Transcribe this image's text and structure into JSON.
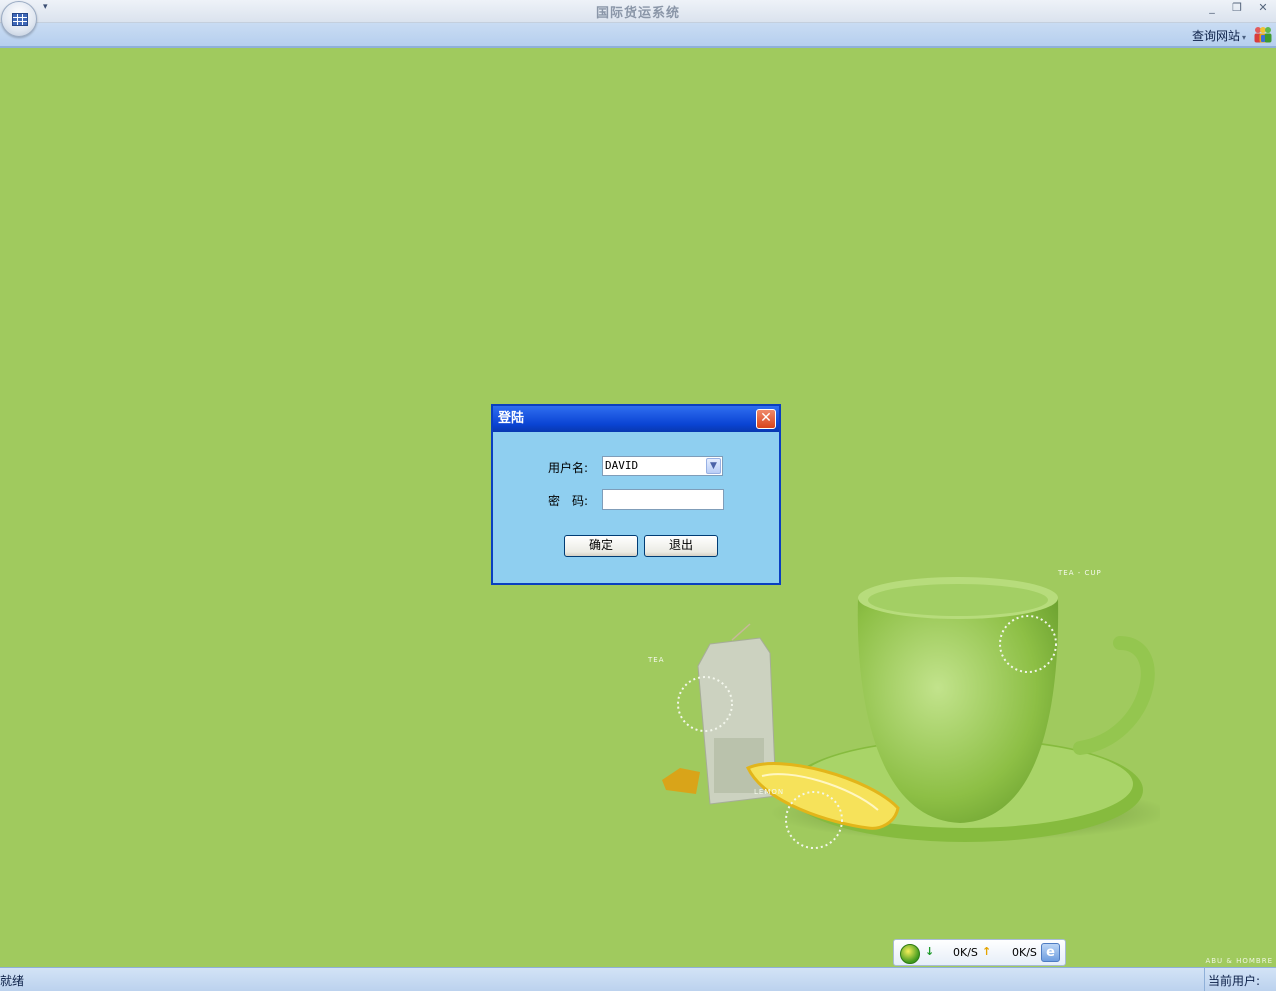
{
  "window": {
    "title": "国际货运系统",
    "minimize_glyph": "_",
    "restore_glyph": "❐",
    "close_glyph": "✕",
    "qat_glyph": "▾"
  },
  "ribbon": {
    "link_label": "查询网站",
    "link_caret": "▾",
    "users_icon": "users-icon"
  },
  "desktop": {
    "watermark": "ABU & HOMBRE",
    "labels": {
      "tea_cup": "TEA - CUP",
      "tea": "TEA",
      "lemon": "LEMON"
    }
  },
  "login_dialog": {
    "title": "登陆",
    "close_glyph": "✕",
    "username_label": "用户名:",
    "username_value": "DAVID",
    "dropdown_glyph": "▼",
    "password_label": "密　码:",
    "password_value": "",
    "ok_label": "确定",
    "exit_label": "退出"
  },
  "speed_widget": {
    "down_glyph": "↓",
    "down_value": "0K/S",
    "up_glyph": "↑",
    "up_value": "0K/S",
    "ie_glyph": "e"
  },
  "status_bar": {
    "status": "就绪",
    "current_user_label": "当前用户:"
  },
  "colors": {
    "desktop_green": "#a0ca5e",
    "dialog_title_blue": "#0a44d4",
    "dialog_body": "#8fcff0"
  }
}
